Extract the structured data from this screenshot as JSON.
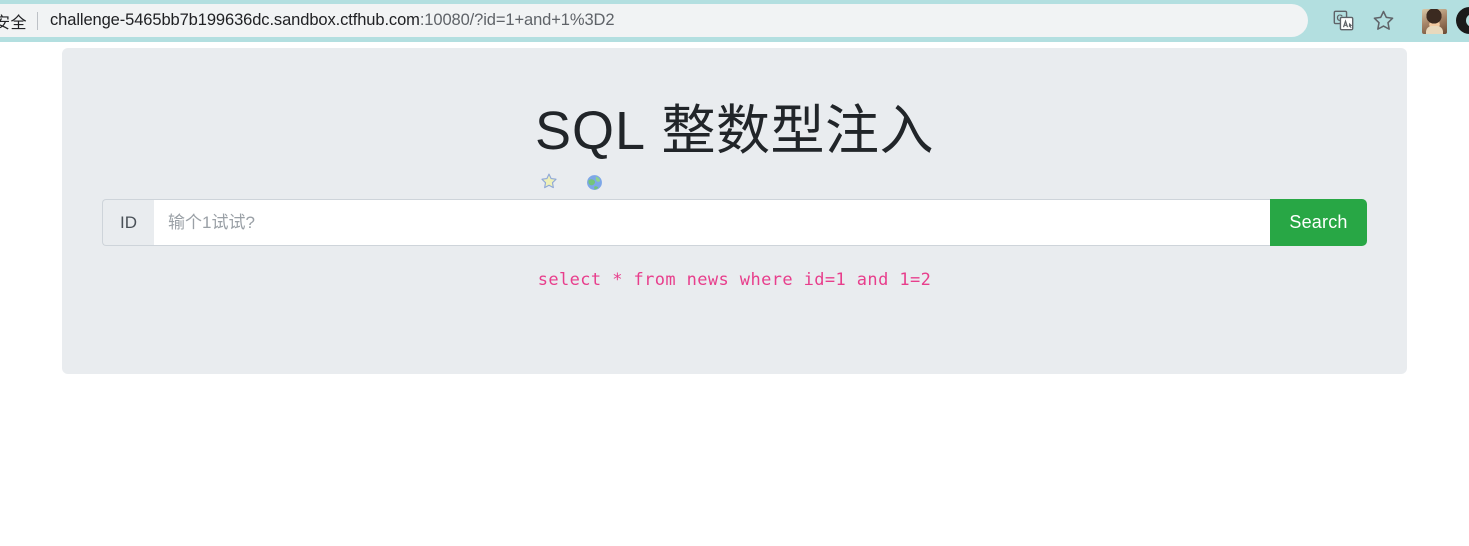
{
  "browser": {
    "security_label": "安全",
    "url_host": "challenge-5465bb7b199636dc.sandbox.ctfhub.com",
    "url_port_path": ":10080/?id=1+and+1%3D2",
    "url_full": "challenge-5465bb7b199636dc.sandbox.ctfhub.com:10080/?id=1+and+1%3D2",
    "icons": {
      "translate": "translate-icon",
      "bookmark": "star-icon",
      "avatar": "profile-avatar",
      "account": "account-circle-icon"
    }
  },
  "page": {
    "title_latin": "SQL",
    "title_cjk": "整数型注入",
    "title_full": "SQL 整数型注入",
    "decorations": {
      "star": "star-decoration-icon",
      "globe": "globe-decoration-icon"
    },
    "form": {
      "prefix_label": "ID",
      "input_value": "",
      "input_placeholder": "输个1试试?",
      "submit_label": "Search"
    },
    "sql_echo": "select * from news where id=1 and 1=2"
  },
  "colors": {
    "chrome_teal": "#b3dfe0",
    "omnibox_bg": "#f1f3f4",
    "panel_bg": "#e9ecef",
    "button_green": "#28a745",
    "sql_pink": "#e83e8c",
    "text_dark": "#212529"
  }
}
